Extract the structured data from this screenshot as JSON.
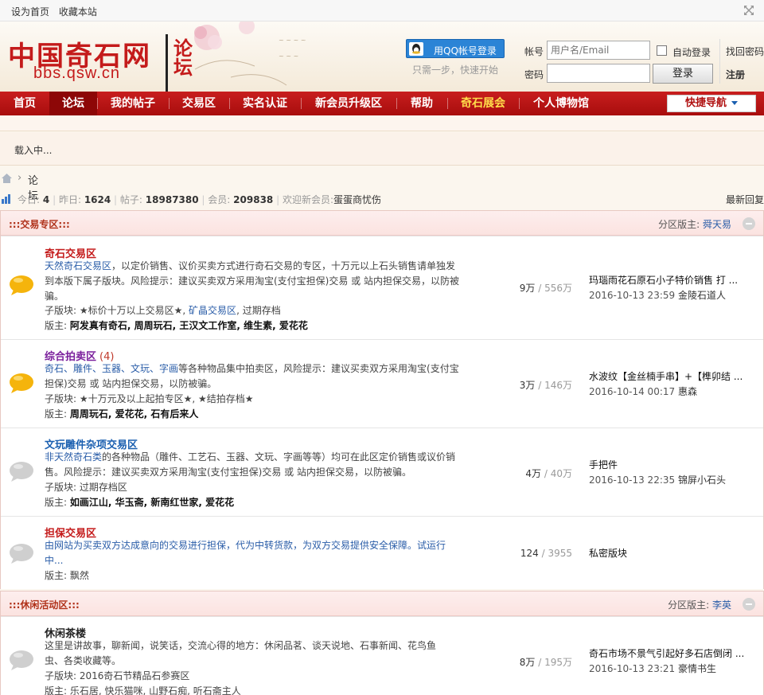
{
  "topbar": {
    "set_home": "设为首页",
    "bookmark": "收藏本站"
  },
  "header": {
    "logo_cn": "中国奇石网",
    "logo_luntan": "论坛",
    "logo_url": "bbs.qsw.cn",
    "qq_login": "用QQ帐号登录",
    "qq_tip": "只需一步，快速开始",
    "account_label": "帐号",
    "account_placeholder": "用户名/Email",
    "password_label": "密码",
    "auto_login": "自动登录",
    "forgot_password": "找回密码",
    "login_button": "登录",
    "register": "注册"
  },
  "nav": {
    "items": [
      "首页",
      "论坛",
      "我的帖子",
      "交易区",
      "实名认证",
      "新会员升级区",
      "帮助",
      "奇石展会",
      "个人博物馆"
    ],
    "quick_nav": "快捷导航"
  },
  "loading_text": "载入中...",
  "breadcrumb": {
    "sep": "›",
    "current": "论坛"
  },
  "stats": {
    "today_label": "今日:",
    "today": "4",
    "yesterday_label": "昨日:",
    "yesterday": "1624",
    "posts_label": "帖子:",
    "posts": "18987380",
    "members_label": "会员:",
    "members": "209838",
    "welcome_label": "欢迎新会员:",
    "newest_member": "蛋蛋商忧伤",
    "latest_replies": "最新回复"
  },
  "categories": [
    {
      "title": ":::交易专区:::",
      "mods_label": "分区版主:",
      "mods": "舜天易",
      "forums": [
        {
          "name": "奇石交易区",
          "today": "",
          "desc_link": "天然奇石交易区",
          "desc": "，以定价销售、议价买卖方式进行奇石交易的专区，十万元以上石头销售请单独发到本版下属子版块。风险提示：建议买卖双方采用淘宝(支付宝担保)交易 或 站内担保交易，以防被骗。",
          "sub_label": "子版块:",
          "subs": [
            "★标价十万以上交易区★",
            "矿晶交易区",
            "过期存档"
          ],
          "mods_label": "版主:",
          "mods": "阿发真有奇石, 周周玩石, 王汉文工作室, 维生素, 爱花花",
          "threads": "9万",
          "posts": "556万",
          "last_title": "玛瑙雨花石原石小子特价销售 打 ...",
          "last_time": "2016-10-13 23:59",
          "last_user": "金陵石道人"
        },
        {
          "name": "综合拍卖区",
          "today": "(4)",
          "desc_link": "奇石、雕件、玉器、文玩、字画",
          "desc": "等各种物品集中拍卖区，风险提示：建议买卖双方采用淘宝(支付宝担保)交易 或 站内担保交易，以防被骗。",
          "sub_label": "子版块:",
          "subs": [
            "★十万元及以上起拍专区★",
            "★结拍存档★"
          ],
          "mods_label": "版主:",
          "mods": "周周玩石, 爱花花, 石有后来人",
          "threads": "3万",
          "posts": "146万",
          "last_title": "水波纹【金丝楠手串】+【榫卯结 ...",
          "last_time": "2016-10-14 00:17",
          "last_user": "惠森"
        },
        {
          "name": "文玩雕件杂项交易区",
          "today": "",
          "desc_link": "非天然奇石类",
          "desc": "的各种物品（雕件、工艺石、玉器、文玩、字画等等）均可在此区定价销售或议价销售。风险提示：建议买卖双方采用淘宝(支付宝担保)交易 或 站内担保交易，以防被骗。",
          "sub_label": "子版块:",
          "subs": [
            "过期存档区"
          ],
          "mods_label": "版主:",
          "mods": "如画江山, 华玉斋, 新南红世家, 爱花花",
          "threads": "4万",
          "posts": "40万",
          "last_title": "手把件",
          "last_time": "2016-10-13 22:35",
          "last_user": "锦屏小石头"
        },
        {
          "name": "担保交易区",
          "today": "",
          "desc_link": "由网站为买卖双方达成意向的交易进行担保，代为中转货款，为双方交易提供安全保障。试运行中...",
          "desc": "",
          "sub_label": "",
          "subs": [],
          "mods_label": "版主:",
          "mods": "飘然",
          "threads": "124",
          "posts": "3955",
          "last_title": "私密版块",
          "last_time": "",
          "last_user": ""
        }
      ]
    },
    {
      "title": ":::休闲活动区:::",
      "mods_label": "分区版主:",
      "mods": "李英",
      "forums": [
        {
          "name": "休闲茶楼",
          "today": "",
          "desc_link": "",
          "desc": "这里是讲故事，聊新闻，说笑话，交流心得的地方：休闲品茗、谈天说地、石事新闻、花鸟鱼虫、各类收藏等。",
          "sub_label": "子版块:",
          "subs": [
            "2016奇石节精品石参赛区"
          ],
          "mods_label": "版主:",
          "mods": "乐石居, 快乐猫咪, 山野石痴, 听石斋主人",
          "threads": "8万",
          "posts": "195万",
          "last_title": "奇石市场不景气引起好多石店倒闭 ...",
          "last_time": "2016-10-13 23:21",
          "last_user": "豪情书生"
        }
      ]
    }
  ]
}
